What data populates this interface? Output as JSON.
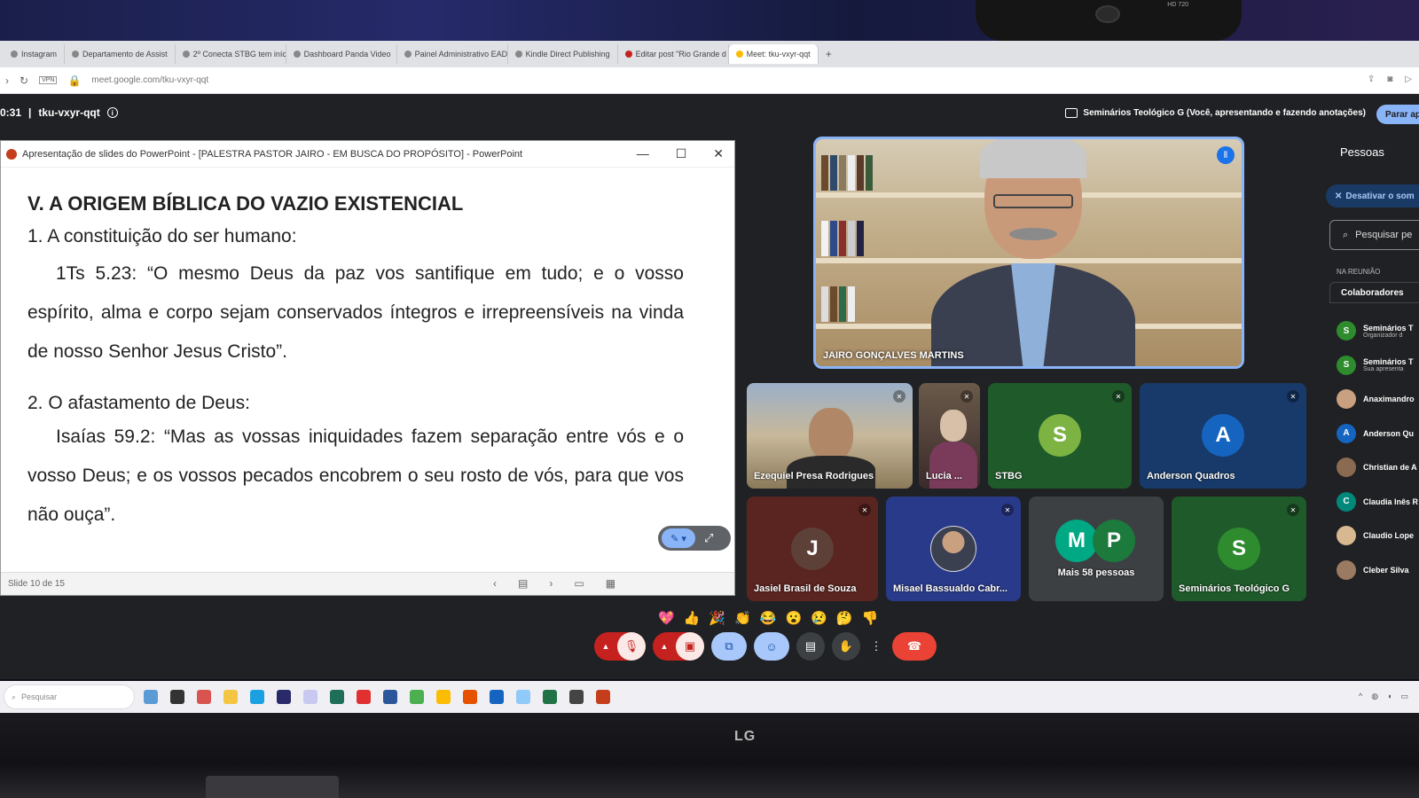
{
  "webcam": {
    "label": "HD 720"
  },
  "browser": {
    "tabs": [
      {
        "label": "Instagram"
      },
      {
        "label": "Departamento de Assist"
      },
      {
        "label": "2º Conecta STBG tem iníc"
      },
      {
        "label": "Dashboard Panda Video"
      },
      {
        "label": "Painel Administrativo EAD"
      },
      {
        "label": "Kindle Direct Publishing"
      },
      {
        "label": "Editar post \"Rio Grande d"
      },
      {
        "label": "Meet: tku-vxyr-qqt",
        "active": true
      }
    ],
    "new_tab": "+",
    "url": "meet.google.com/tku-vxyr-qqt",
    "vpn": "VPN"
  },
  "meet": {
    "time": "0:31",
    "separator": "|",
    "code": "tku-vxyr-qqt",
    "presenting_status": "Seminários Teológico G (Você, apresentando e fazendo anotações)",
    "stop_label": "Parar ap",
    "speaker": {
      "name": "JAIRO GONÇALVES MARTINS"
    },
    "tiles": [
      {
        "name": "Ezequiel Presa Rodrigues"
      },
      {
        "name": "Lucia ..."
      },
      {
        "name": "STBG",
        "initial": "S",
        "color": "#7cb342"
      },
      {
        "name": "Anderson Quadros",
        "initial": "A",
        "color": "#1565c0"
      },
      {
        "name": "Jasiel Brasil de Souza",
        "initial": "J",
        "color": "#5d4037"
      },
      {
        "name": "Misael Bassualdo Cabr..."
      },
      {
        "name": "Mais 58 pessoas",
        "initials": [
          "M",
          "P"
        ],
        "colors": [
          "#00a884",
          "#1b7a3c"
        ]
      },
      {
        "name": "Seminários Teológico G",
        "initial": "S",
        "color": "#2e8b2e"
      }
    ],
    "reactions": [
      "💖",
      "👍",
      "🎉",
      "👏",
      "😂",
      "😮",
      "😢",
      "🤔",
      "👎"
    ]
  },
  "powerpoint": {
    "window_title": "Apresentação de slides do PowerPoint - [PALESTRA PASTOR JAIRO - EM BUSCA DO PROPÓSITO] - PowerPoint",
    "slide": {
      "heading": "V. A ORIGEM BÍBLICA DO VAZIO EXISTENCIAL",
      "point1": "1. A constituição do ser humano:",
      "quote1": "1Ts 5.23: “O mesmo Deus da paz vos santifique em tudo; e o vosso espírito, alma e corpo sejam conservados íntegros e irrepreensíveis na vinda de nosso Senhor Jesus Cristo”.",
      "point2": "2. O afastamento de Deus:",
      "quote2": "Isaías 59.2: “Mas as vossas iniquidades fazem separação entre vós e o vosso Deus; e os vossos pecados encobrem o seu rosto de vós, para que vos não ouça”."
    },
    "slide_counter": "Slide 10 de 15"
  },
  "people_panel": {
    "title": "Pessoas",
    "mute_all": "Desativar o som",
    "search_placeholder": "Pesquisar pe",
    "section": "NA REUNIÃO",
    "group": "Colaboradores",
    "participants": [
      {
        "name": "Seminários T",
        "sub": "Organizador d",
        "initial": "S",
        "color": "#2e8b2e"
      },
      {
        "name": "Seminários T",
        "sub": "Sua apresenta",
        "initial": "S",
        "color": "#2e8b2e"
      },
      {
        "name": "Anaximandro",
        "sub": "",
        "initial": "",
        "color": "#c9a080"
      },
      {
        "name": "Anderson Qu",
        "sub": "",
        "initial": "A",
        "color": "#1565c0"
      },
      {
        "name": "Christian de A",
        "sub": "",
        "initial": "",
        "color": "#8a6a50"
      },
      {
        "name": "Claudia Inês R",
        "sub": "",
        "initial": "C",
        "color": "#00897b"
      },
      {
        "name": "Claudio Lope",
        "sub": "",
        "initial": "",
        "color": "#d8b890"
      },
      {
        "name": "Cleber Silva",
        "sub": "",
        "initial": "",
        "color": "#9a7a60"
      }
    ]
  },
  "taskbar": {
    "search": "Pesquisar"
  },
  "monitor": {
    "brand": "LG"
  }
}
